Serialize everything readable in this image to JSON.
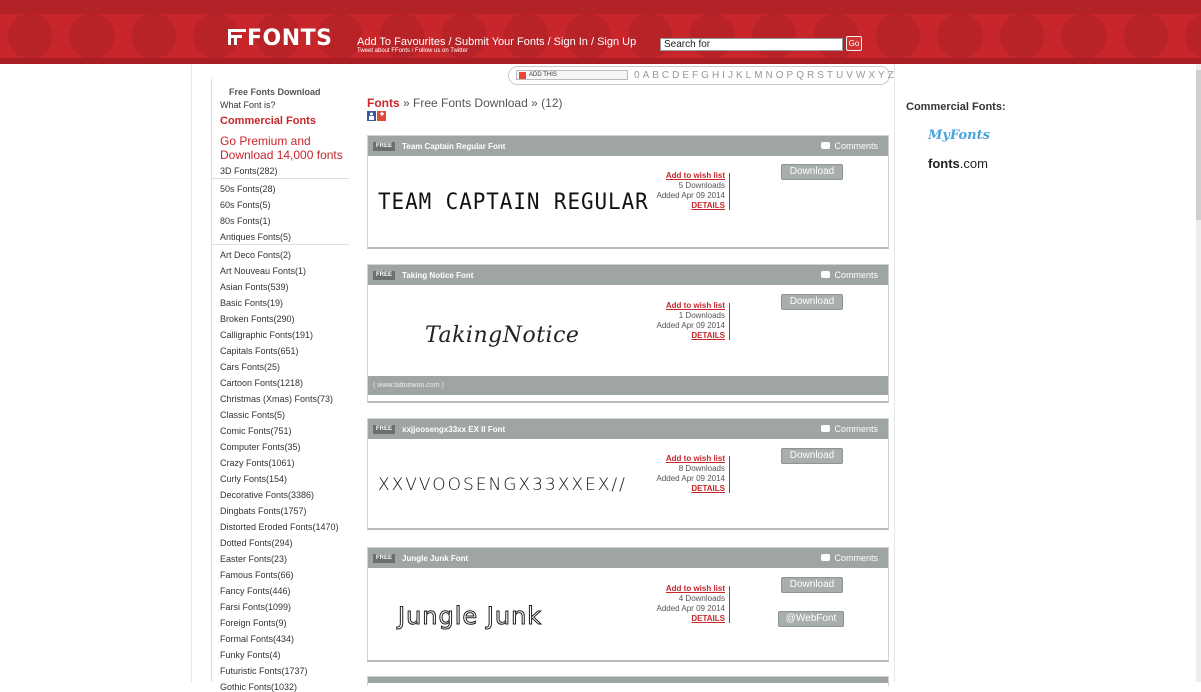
{
  "header": {
    "logo_text": "FONTS",
    "links": "Add To Favourites / Submit Your Fonts / Sign In / Sign Up",
    "sublinks": "Tweet about FFonts / Follow us on Twitter",
    "search_placeholder": "Search for",
    "go_label": "Go",
    "accent_color": "#c8262b"
  },
  "alpha_bar": {
    "addthis_label": "ADD THIS",
    "letters": [
      "0",
      "A",
      "B",
      "C",
      "D",
      "E",
      "F",
      "G",
      "H",
      "I",
      "J",
      "K",
      "L",
      "M",
      "N",
      "O",
      "P",
      "Q",
      "R",
      "S",
      "T",
      "U",
      "V",
      "W",
      "X",
      "Y",
      "Z"
    ]
  },
  "sidebar": {
    "title": "Free Fonts Download",
    "what_font": "What Font is?",
    "commercial": "Commercial Fonts",
    "premium_line1": "Go Premium and",
    "premium_line2": "Download 14,000 fonts",
    "categories": [
      "3D Fonts(282)",
      "50s Fonts(28)",
      "60s Fonts(5)",
      "80s Fonts(1)",
      "Antiques Fonts(5)",
      "Art Deco Fonts(2)",
      "Art Nouveau Fonts(1)",
      "Asian Fonts(539)",
      "Basic Fonts(19)",
      "Broken Fonts(290)",
      "Calligraphic Fonts(191)",
      "Capitals Fonts(651)",
      "Cars Fonts(25)",
      "Cartoon Fonts(1218)",
      "Christmas (Xmas) Fonts(73)",
      "Classic Fonts(5)",
      "Comic Fonts(751)",
      "Computer Fonts(35)",
      "Crazy Fonts(1061)",
      "Curly Fonts(154)",
      "Decorative Fonts(3386)",
      "Dingbats Fonts(1757)",
      "Distorted Eroded Fonts(1470)",
      "Dotted Fonts(294)",
      "Easter Fonts(23)",
      "Famous Fonts(66)",
      "Fancy Fonts(446)",
      "Farsi Fonts(1099)",
      "Foreign Fonts(9)",
      "Formal Fonts(434)",
      "Funky Fonts(4)",
      "Futuristic Fonts(1737)",
      "Gothic Fonts(1032)"
    ]
  },
  "breadcrumb": {
    "home": "Fonts",
    "sep": "»",
    "section": "Free Fonts Download",
    "count": "(12)"
  },
  "cards": [
    {
      "badge": "FREE",
      "title": "Team Captain Regular Font",
      "comments": "Comments",
      "preview": "TEAM CAPTAIN REGULAR",
      "wish": "Add to wish list",
      "downloads": "5 Downloads",
      "added": "Added Apr 09 2014",
      "details": "DETAILS",
      "download": "Download"
    },
    {
      "badge": "FREE",
      "title": "Taking Notice Font",
      "comments": "Comments",
      "preview": "TakingNotice",
      "wish": "Add to wish list",
      "downloads": "1 Downloads",
      "added": "Added Apr 09 2014",
      "details": "DETAILS",
      "download": "Download",
      "footer": "( www.tattoowoo.com )"
    },
    {
      "badge": "FREE",
      "title": "xxjjoosengx33xx EX II Font",
      "comments": "Comments",
      "preview": "XXVVOOSENGX33XXEX//",
      "wish": "Add to wish list",
      "downloads": "8 Downloads",
      "added": "Added Apr 09 2014",
      "details": "DETAILS",
      "download": "Download"
    },
    {
      "badge": "FREE",
      "title": "Jungle Junk Font",
      "comments": "Comments",
      "preview": "Jungle Junk",
      "wish": "Add to wish list",
      "downloads": "4 Downloads",
      "added": "Added Apr 09 2014",
      "details": "DETAILS",
      "download": "Download",
      "webfont": "@WebFont"
    }
  ],
  "right": {
    "title": "Commercial Fonts:",
    "myfonts": "MyFonts",
    "fontscom_bold": "fonts",
    "fontscom_rest": ".com"
  }
}
